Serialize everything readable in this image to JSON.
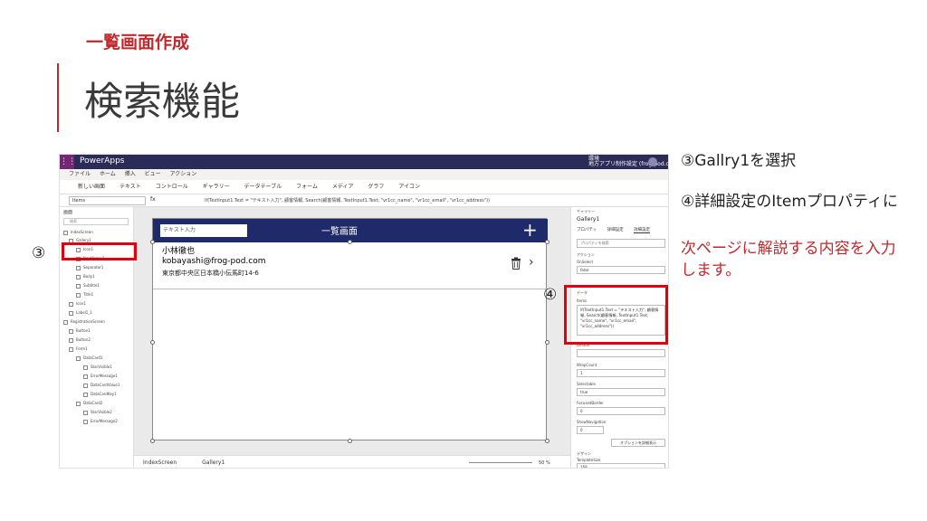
{
  "slide": {
    "subtitle": "一覧画面作成",
    "title": "検索機能",
    "accent_color": "#c0282d"
  },
  "annotations": {
    "mark3": "③",
    "mark4": "④",
    "note1": "③Gallry1を選択",
    "note2": "④詳細設定のItemプロパティに",
    "note3": "次ページに解説する内容を入力します。",
    "highlight_color": "#e0000f"
  },
  "app": {
    "name": "PowerApps",
    "env_label": "環境\n地方アプリ制作設定 (frog-pod.com)",
    "menu": [
      "ファイル",
      "ホーム",
      "挿入",
      "ビュー",
      "アクション"
    ],
    "ribbon": [
      "新しい画面",
      "テキスト",
      "コントロール",
      "ギャラリー",
      "データテーブル",
      "フォーム",
      "メディア",
      "グラフ",
      "アイコン"
    ],
    "formula_bar": {
      "property": "Items",
      "fx": "fx",
      "formula": "If(TextInput1.Text = \"テキスト入力\", 顧客情報, Search(顧客情報, TextInput1.Text, \"vr1cc_name\", \"vr1cc_email\", \"vr1cc_address\"))"
    },
    "tree": {
      "title": "画面",
      "search_placeholder": "検索",
      "items": [
        "IndexScreen",
        "Gallery1",
        "Icon1",
        "NextArrow1",
        "Separator1",
        "Body1",
        "Subtitle1",
        "Title1",
        "Icon1",
        "Label1_1",
        "RegistrationScreen",
        "Button1",
        "Button2",
        "Form1",
        "DataCard1",
        "StarVisible1",
        "ErrorMessage1",
        "DataCardValue1",
        "DataCardKey1",
        "DataCard2",
        "StarVisible2",
        "ErrorMessage2"
      ]
    },
    "canvas": {
      "search_placeholder": "テキスト入力",
      "screen_title": "一覧画面",
      "gallery_item": {
        "name": "小林徹也",
        "email": "kobayashi@frog-pod.com",
        "address": "東京都中央区日本橋小伝馬町14-6"
      },
      "tabs": [
        "IndexScreen",
        "Gallery1"
      ],
      "zoom": "50 %"
    },
    "properties": {
      "kind": "ギャラリー",
      "name": "Gallery1",
      "tabs": [
        "プロパティ",
        "詳細設定",
        "詳細設定"
      ],
      "dropdown": "プロパティを検索",
      "sections": [
        {
          "label": "アクション"
        },
        {
          "label": "OnSelect",
          "value": "false"
        },
        {
          "label": "データ"
        },
        {
          "label": "Items"
        },
        {
          "label": "Default"
        },
        {
          "label": "WrapCount",
          "value": "1"
        },
        {
          "label": "Selectable",
          "value": "true"
        },
        {
          "label": "FocusedBorder",
          "value": "0"
        },
        {
          "label": "ShowNavigation",
          "value": "0"
        },
        {
          "label": "デザイン"
        },
        {
          "label": "TemplateSize",
          "value": "168"
        }
      ],
      "items_formula": "If(TextInput1.Text = \"テキスト入力\", 顧客情報, Search(顧客情報, TextInput1.Text, \"vr1cc_name\", \"vr1cc_email\", \"vr1cc_address\"))",
      "advanced_button": "オプションを詳細表示"
    }
  }
}
